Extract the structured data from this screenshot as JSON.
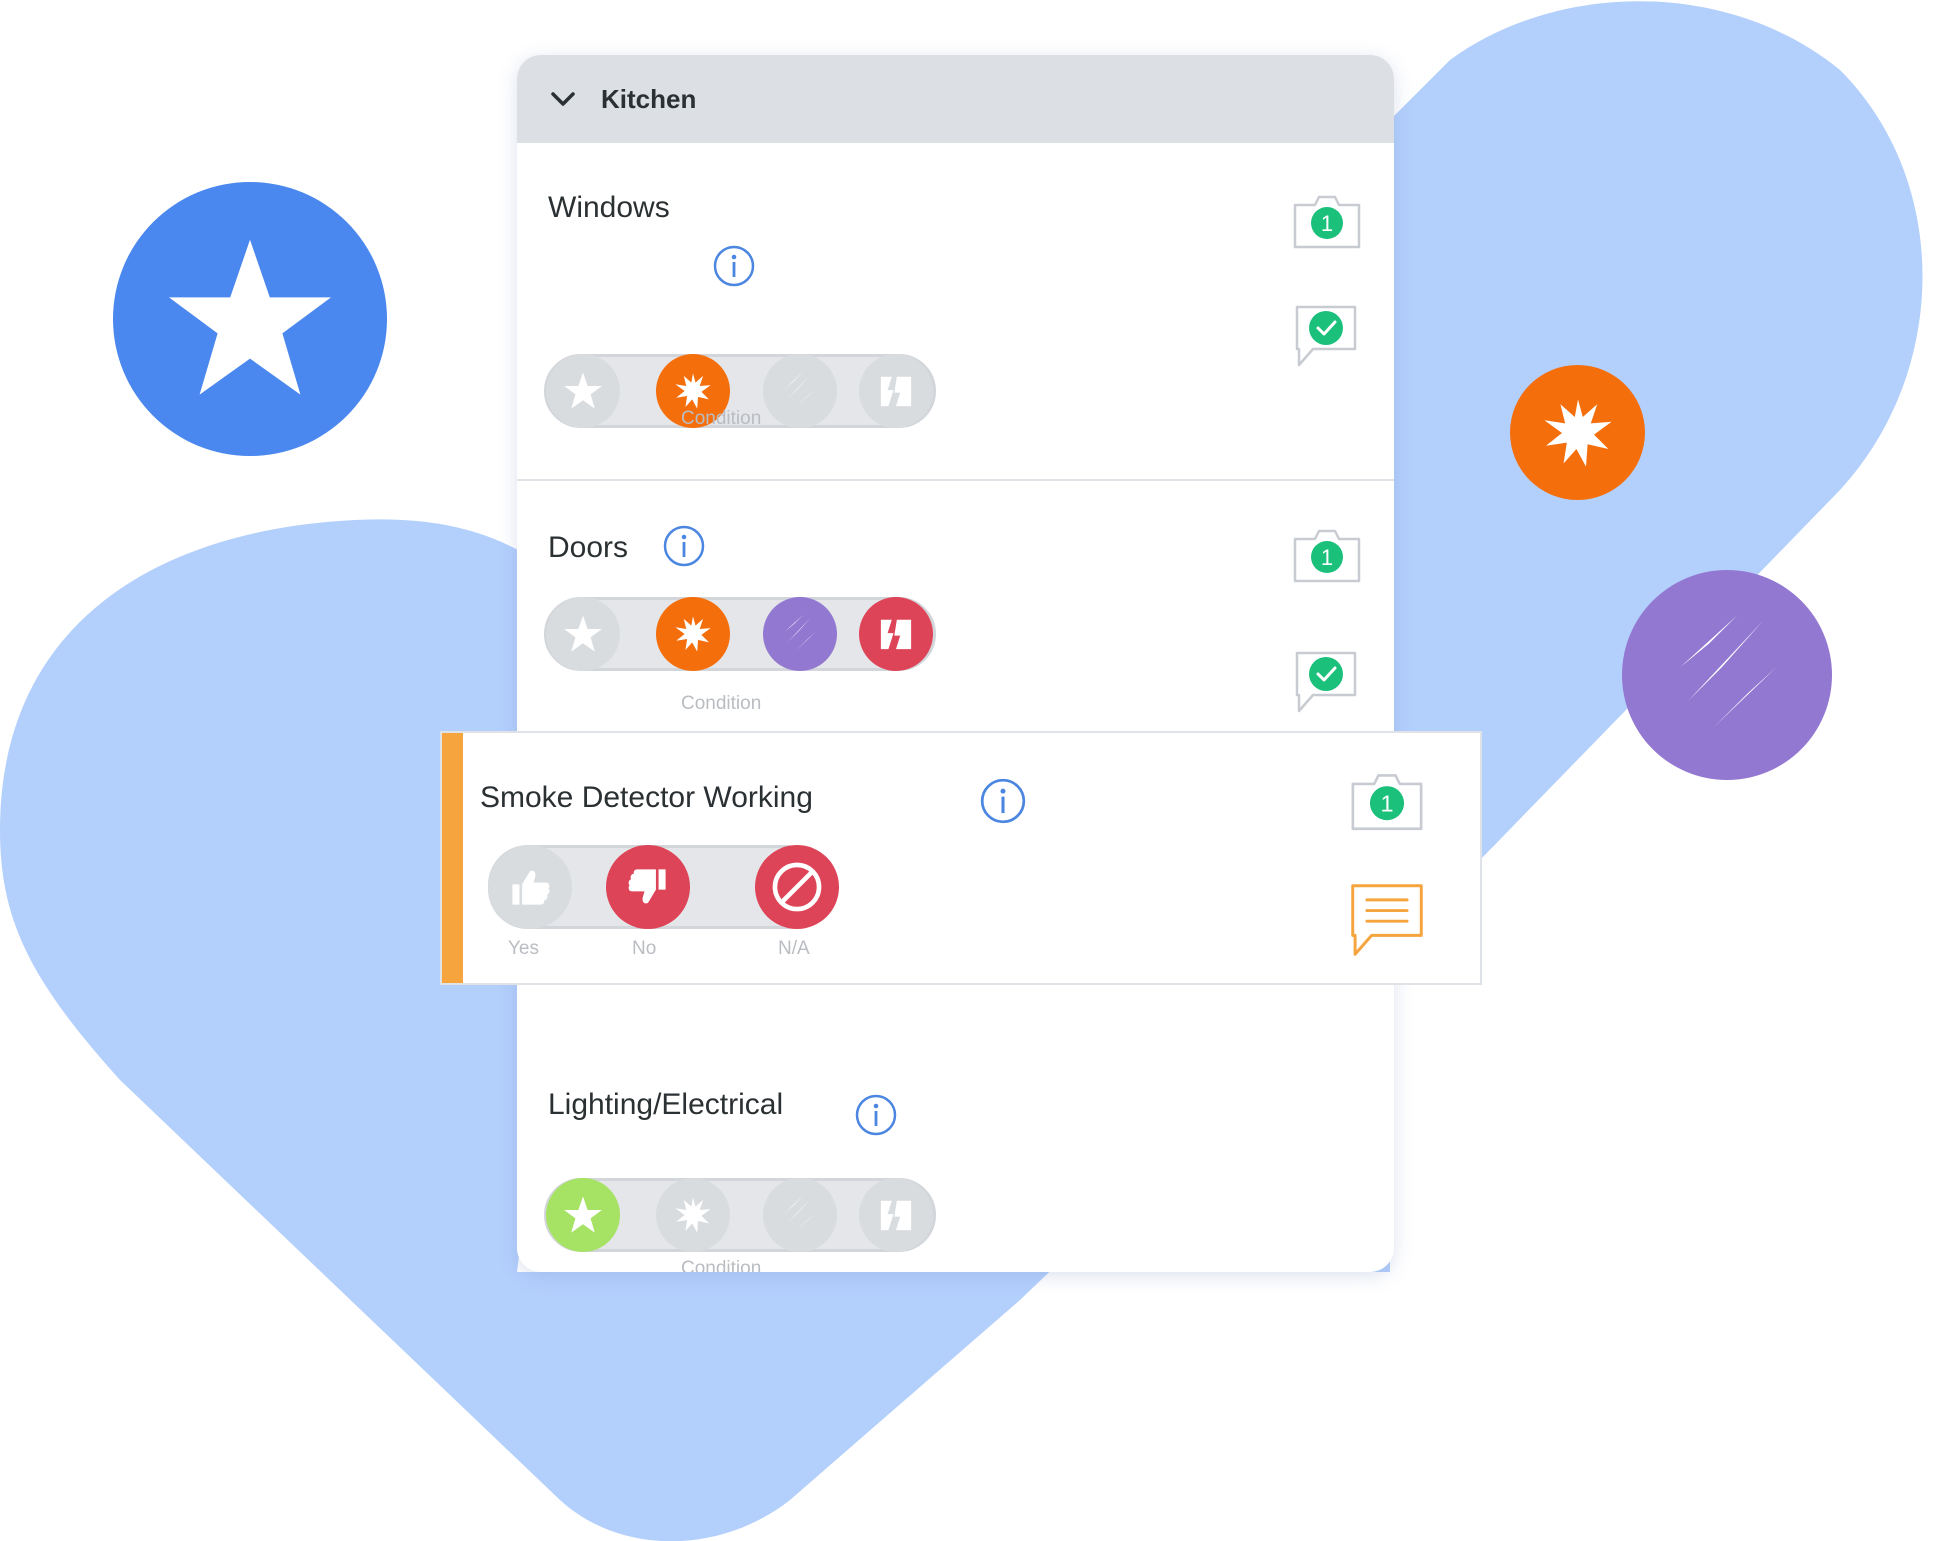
{
  "colors": {
    "blob": "#b3cffc",
    "star_blue": "#4a87ee",
    "orange": "#f56e0c",
    "purple": "#9378d2",
    "red": "#de4458",
    "green": "#a6e264",
    "badge_green": "#1bc07b",
    "info_blue": "#4b86e0",
    "highlight_orange": "#f6a43e",
    "grey_icon": "#d9dcdf"
  },
  "section": {
    "title": "Kitchen",
    "collapse_icon": "chevron-down-icon"
  },
  "items": [
    {
      "title": "Windows",
      "caption": "Condition",
      "photo_count": "1",
      "options": [
        "excellent (star)",
        "stain (splat)",
        "scratch",
        "broken"
      ],
      "selected": "stain"
    },
    {
      "title": "Doors",
      "caption": "Condition",
      "photo_count": "1",
      "options": [
        "excellent (star)",
        "stain (splat)",
        "scratch",
        "broken"
      ],
      "selected": [
        "stain",
        "scratch",
        "broken"
      ]
    },
    {
      "title": "Smoke Detector Working",
      "photo_count": "1",
      "options": [
        "Yes",
        "No",
        "N/A"
      ],
      "selected": [
        "No",
        "N/A"
      ]
    },
    {
      "title": "Lighting/Electrical",
      "caption": "Condition",
      "options": [
        "excellent (star)",
        "stain (splat)",
        "scratch",
        "broken"
      ],
      "selected": "excellent"
    }
  ],
  "smoke": {
    "yes_label": "Yes",
    "no_label": "No",
    "na_label": "N/A"
  }
}
